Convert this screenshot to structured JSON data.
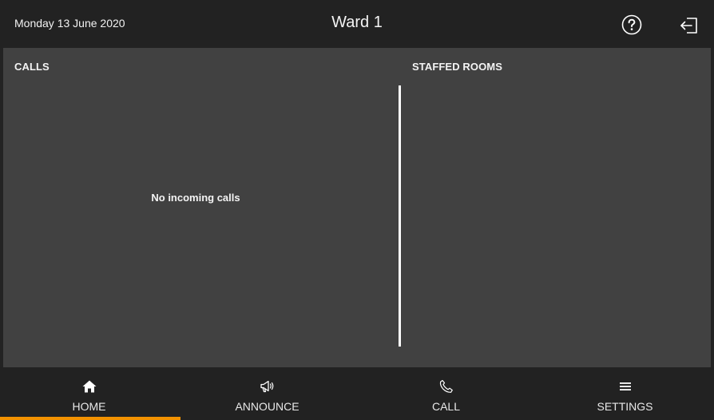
{
  "header": {
    "date": "Monday 13 June 2020",
    "title": "Ward 1",
    "help_icon": "question-circle-icon",
    "logout_icon": "logout-arrow-icon"
  },
  "calls": {
    "heading": "CALLS",
    "empty_message": "No incoming calls"
  },
  "staffed_rooms": {
    "heading": "STAFFED ROOMS"
  },
  "nav": {
    "active": "home",
    "items": [
      {
        "label": "HOME",
        "icon": "home-icon"
      },
      {
        "label": "ANNOUNCE",
        "icon": "megaphone-icon"
      },
      {
        "label": "CALL",
        "icon": "phone-icon"
      },
      {
        "label": "SETTINGS",
        "icon": "menu-icon"
      }
    ]
  },
  "colors": {
    "header_bg": "#222222",
    "content_bg": "#414141",
    "accent": "#f39200"
  }
}
